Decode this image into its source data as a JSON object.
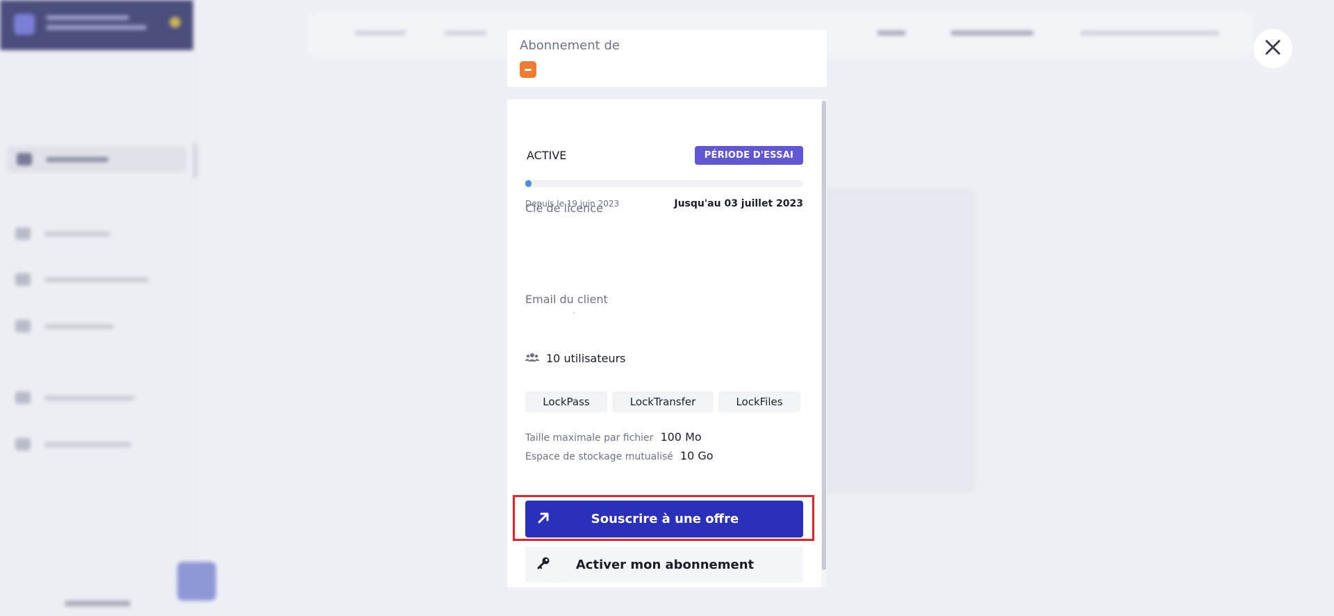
{
  "modal": {
    "title": "Abonnement de",
    "status": "ACTIVE",
    "trial_badge": "PÉRIODE D'ESSAI",
    "trial_progress": 0.02,
    "since": "Depuis le 19 juin 2023",
    "until": "Jusqu'au 03 juillet 2023",
    "license_label": "Clé de licence",
    "email_label": "Email du client",
    "email_value": "·",
    "users": "10 utilisateurs",
    "products": [
      "LockPass",
      "LockTransfer",
      "LockFiles"
    ],
    "max_file_label": "Taille maximale par fichier",
    "max_file_value": "100 Mo",
    "storage_label": "Espace de stockage mutualisé",
    "storage_value": "10 Go",
    "subscribe_button": "Souscrire à une offre",
    "activate_button": "Activer mon abonnement"
  },
  "colors": {
    "primary": "#2a30b9",
    "trial_badge": "#6257d3",
    "product_badge": "#f07c34",
    "highlight": "#e3242b",
    "progress": "#4f8fd8"
  },
  "icons": {
    "close": "close-icon",
    "users": "users-icon",
    "subscribe": "arrow-up-right-icon",
    "activate": "key-icon"
  }
}
